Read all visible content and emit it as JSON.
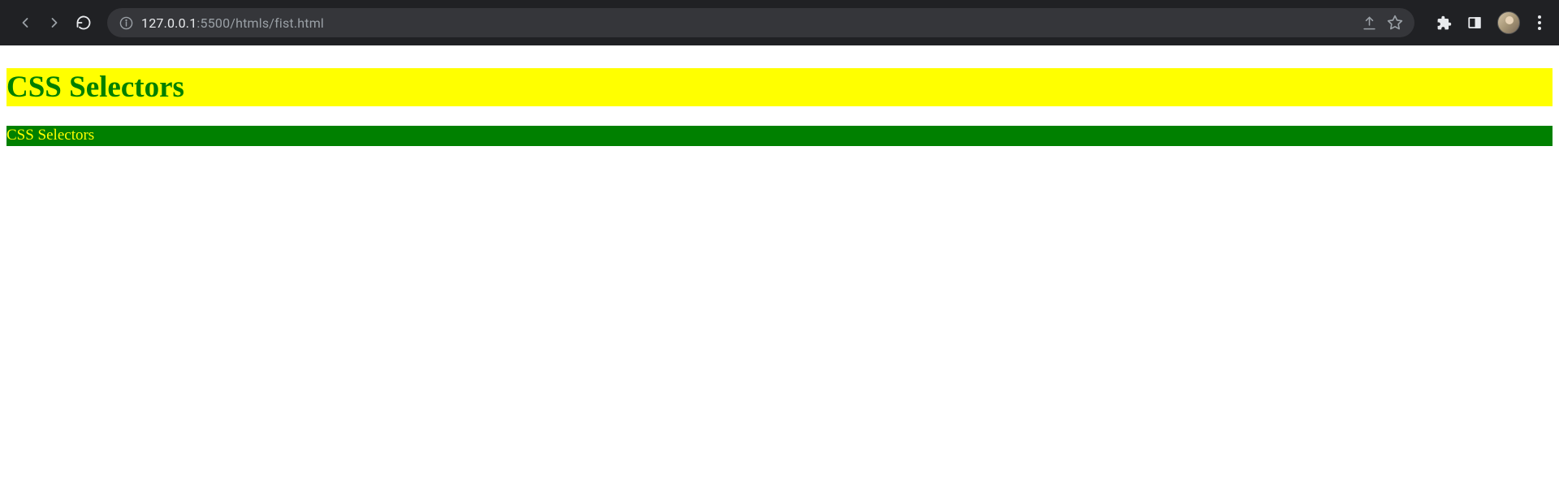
{
  "url": {
    "host": "127.0.0.1",
    "port_path": ":5500/htmls/fist.html"
  },
  "content": {
    "heading": "CSS Selectors",
    "paragraph": "CSS Selectors"
  }
}
